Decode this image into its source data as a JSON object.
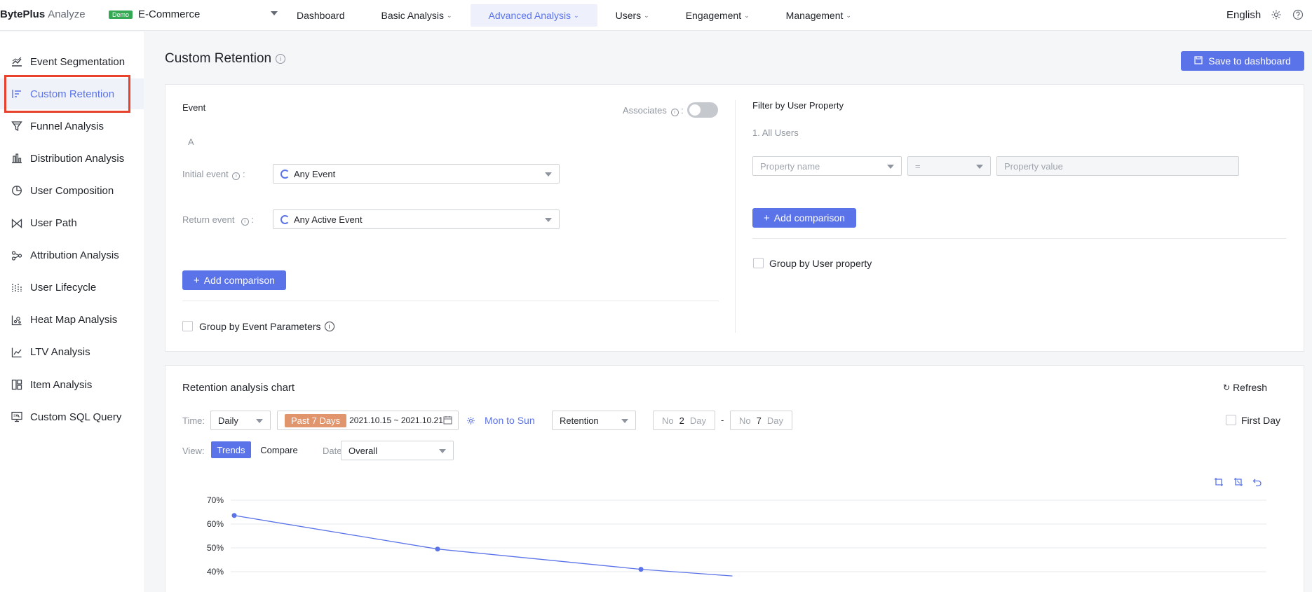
{
  "topbar": {
    "brand": "BytePlus",
    "brand_sub": "Analyze",
    "demo_badge": "Demo",
    "project": "E-Commerce",
    "nav": [
      {
        "label": "Dashboard",
        "caret": false,
        "active": false
      },
      {
        "label": "Basic Analysis",
        "caret": true,
        "active": false
      },
      {
        "label": "Advanced Analysis",
        "caret": true,
        "active": true
      },
      {
        "label": "Users",
        "caret": true,
        "active": false
      },
      {
        "label": "Engagement",
        "caret": true,
        "active": false
      },
      {
        "label": "Management",
        "caret": true,
        "active": false
      }
    ],
    "language": "English"
  },
  "sidebar": {
    "items": [
      {
        "label": "Event Segmentation",
        "icon": "line-chart-icon",
        "active": false
      },
      {
        "label": "Custom Retention",
        "icon": "retention-icon",
        "active": true
      },
      {
        "label": "Funnel Analysis",
        "icon": "funnel-icon",
        "active": false
      },
      {
        "label": "Distribution Analysis",
        "icon": "bar-chart-icon",
        "active": false
      },
      {
        "label": "User Composition",
        "icon": "pie-chart-icon",
        "active": false
      },
      {
        "label": "User Path",
        "icon": "path-icon",
        "active": false
      },
      {
        "label": "Attribution Analysis",
        "icon": "attribution-icon",
        "active": false
      },
      {
        "label": "User Lifecycle",
        "icon": "lifecycle-icon",
        "active": false
      },
      {
        "label": "Heat Map Analysis",
        "icon": "heatmap-icon",
        "active": false
      },
      {
        "label": "LTV Analysis",
        "icon": "ltv-icon",
        "active": false
      },
      {
        "label": "Item Analysis",
        "icon": "item-icon",
        "active": false
      },
      {
        "label": "Custom SQL Query",
        "icon": "sql-icon",
        "active": false
      }
    ]
  },
  "page": {
    "title": "Custom Retention",
    "save_button": "Save to dashboard"
  },
  "event_panel": {
    "heading": "Event",
    "associates_label": "Associates",
    "group_label": "A",
    "initial_event_label": "Initial event",
    "initial_event_value": "Any Event",
    "return_event_label": "Return event",
    "return_event_value": "Any Active Event",
    "add_comparison": "Add comparison",
    "group_by_label": "Group by Event Parameters"
  },
  "filter_panel": {
    "heading": "Filter by User Property",
    "users_label": "1. All Users",
    "property_name_placeholder": "Property name",
    "operator": "=",
    "property_value_placeholder": "Property value",
    "add_comparison": "Add comparison",
    "group_by_label": "Group by User property"
  },
  "chart_card": {
    "title": "Retention analysis chart",
    "refresh": "Refresh",
    "time_label": "Time:",
    "granularity": "Daily",
    "range_tag": "Past 7 Days",
    "date_range": "2021.10.15 ~ 2021.10.21",
    "week_link": "Mon to Sun",
    "metric": "Retention",
    "no_prefix": "No",
    "day_suffix": "Day",
    "from_day": "2",
    "to_day": "7",
    "range_dash": "-",
    "first_day_label": "First Day",
    "view_label": "View:",
    "view_trends": "Trends",
    "view_compare": "Compare",
    "date_label": "Date:",
    "date_value": "Overall"
  },
  "colors": {
    "accent": "#5b73e8",
    "highlight": "#e8412c",
    "range_tag": "#e0956c"
  },
  "chart_data": {
    "type": "line",
    "y_ticks": [
      "70%",
      "60%",
      "50%",
      "40%"
    ],
    "ylim": [
      40,
      70
    ],
    "x_positions": [
      0,
      1,
      2,
      2.45
    ],
    "series": [
      {
        "values": [
          63.6,
          49.5,
          41.0,
          38.2
        ]
      }
    ]
  }
}
